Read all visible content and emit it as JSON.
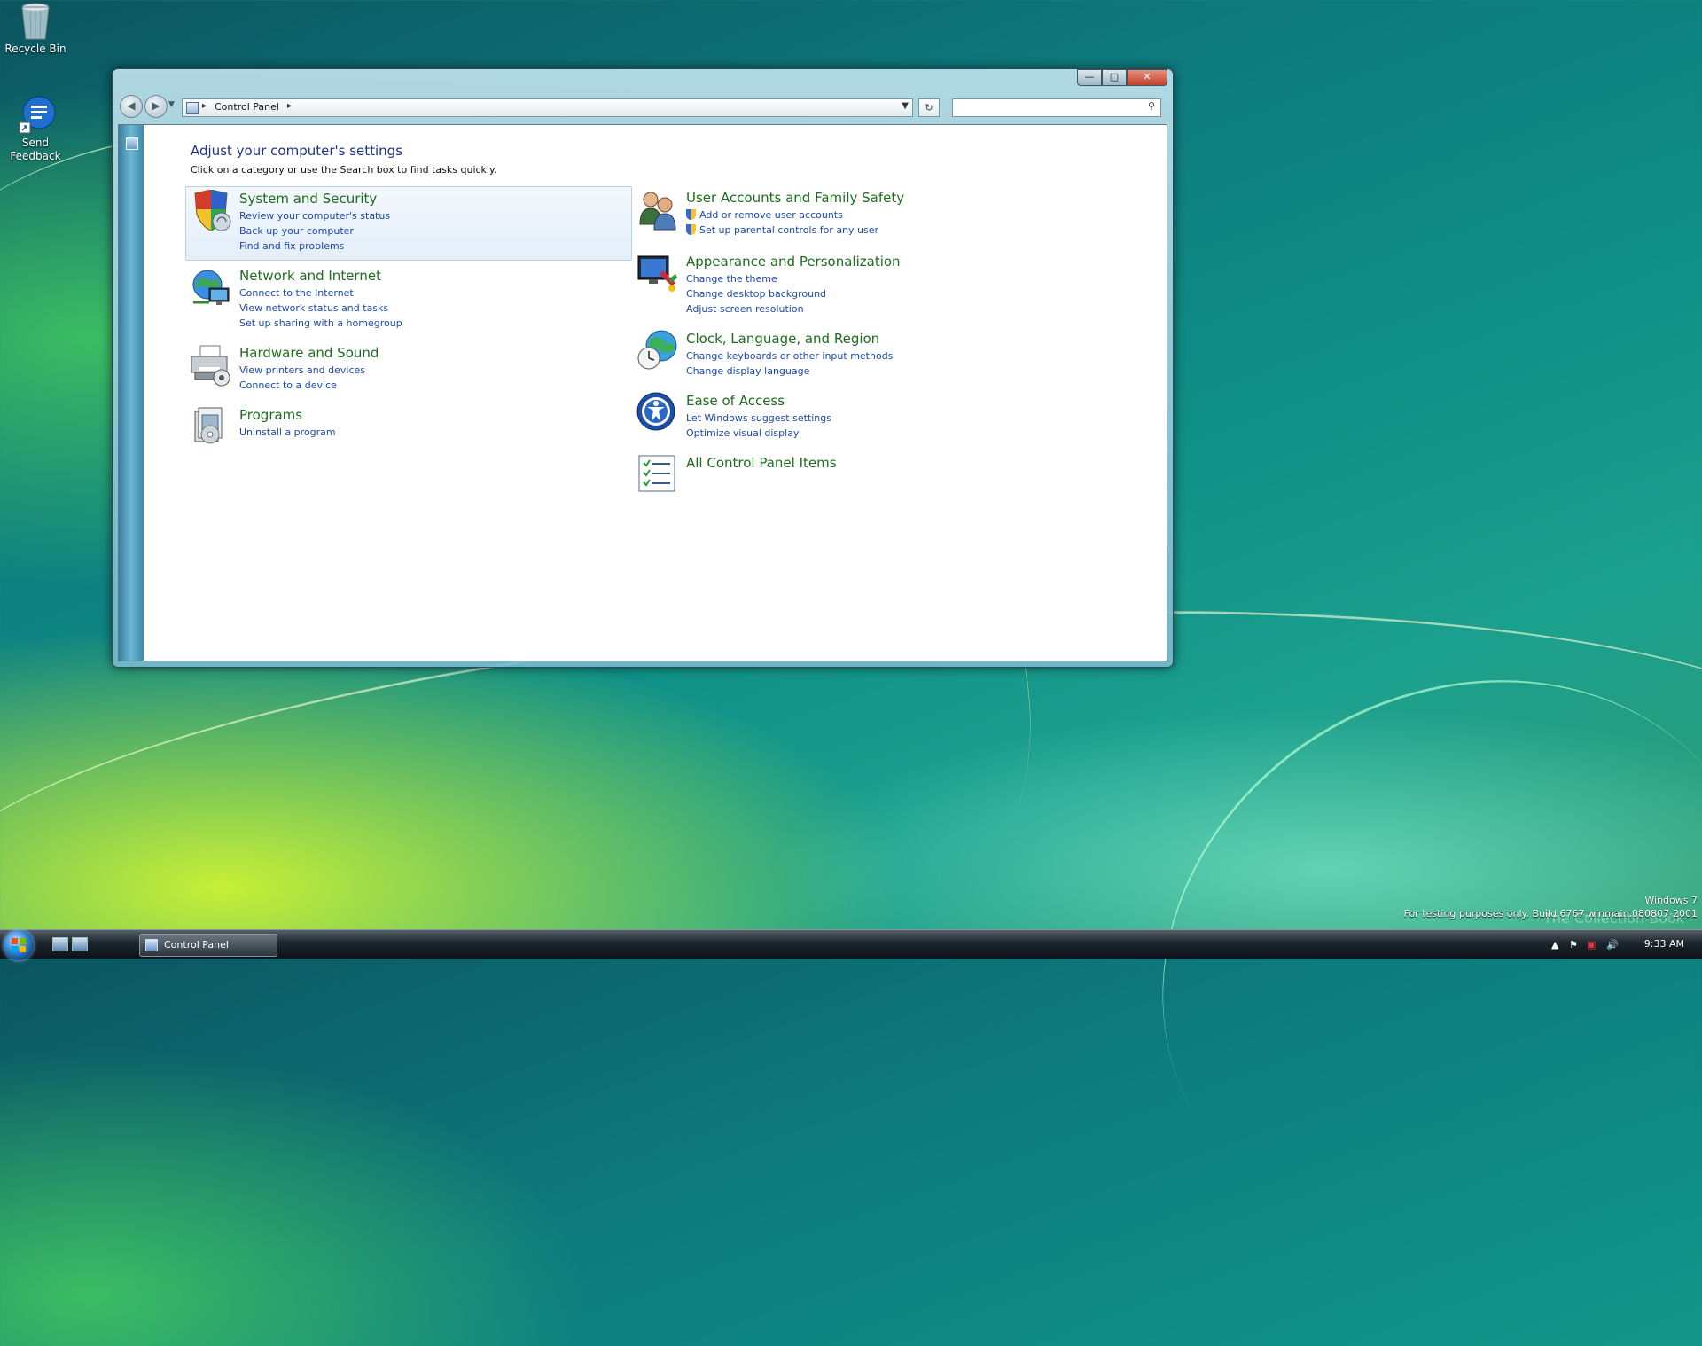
{
  "desktop": {
    "icons": [
      {
        "label": "Recycle Bin"
      },
      {
        "label": "Send\nFeedback"
      }
    ]
  },
  "window": {
    "address": {
      "crumb": "Control Panel",
      "search_placeholder": ""
    },
    "heading": "Adjust your computer's settings",
    "subheading": "Click on a category or use the Search box to find tasks quickly.",
    "categories_left": [
      {
        "title": "System and Security",
        "icon": "shield-icon",
        "links": [
          "Review your computer's status",
          "Back up your computer",
          "Find and fix problems"
        ]
      },
      {
        "title": "Network and Internet",
        "icon": "globe-network-icon",
        "links": [
          "Connect to the Internet",
          "View network status and tasks",
          "Set up sharing with a homegroup"
        ]
      },
      {
        "title": "Hardware and Sound",
        "icon": "printer-speaker-icon",
        "links": [
          "View printers and devices",
          "Connect to a device"
        ]
      },
      {
        "title": "Programs",
        "icon": "programs-icon",
        "links": [
          "Uninstall a program"
        ]
      }
    ],
    "categories_right": [
      {
        "title": "User Accounts and Family Safety",
        "icon": "users-icon",
        "links": [
          "Add or remove user accounts",
          "Set up parental controls for any user"
        ]
      },
      {
        "title": "Appearance and Personalization",
        "icon": "monitor-paint-icon",
        "links": [
          "Change the theme",
          "Change desktop background",
          "Adjust screen resolution"
        ]
      },
      {
        "title": "Clock, Language, and Region",
        "icon": "globe-clock-icon",
        "links": [
          "Change keyboards or other input methods",
          "Change display language"
        ]
      },
      {
        "title": "Ease of Access",
        "icon": "ease-of-access-icon",
        "links": [
          "Let Windows suggest settings",
          "Optimize visual display"
        ]
      },
      {
        "title": "All Control Panel Items",
        "icon": "checklist-icon",
        "links": []
      }
    ]
  },
  "taskbar": {
    "task_label": "Control Panel",
    "clock": "9:33 AM"
  },
  "watermark": {
    "line1": "Windows 7",
    "line2": "For testing purposes only. Build 6767.winmain.080807-2001",
    "overlay": "The Collection Book"
  },
  "colors": {
    "link": "#1c49b0",
    "category_title": "#1e6d1e",
    "heading": "#1e3287"
  }
}
